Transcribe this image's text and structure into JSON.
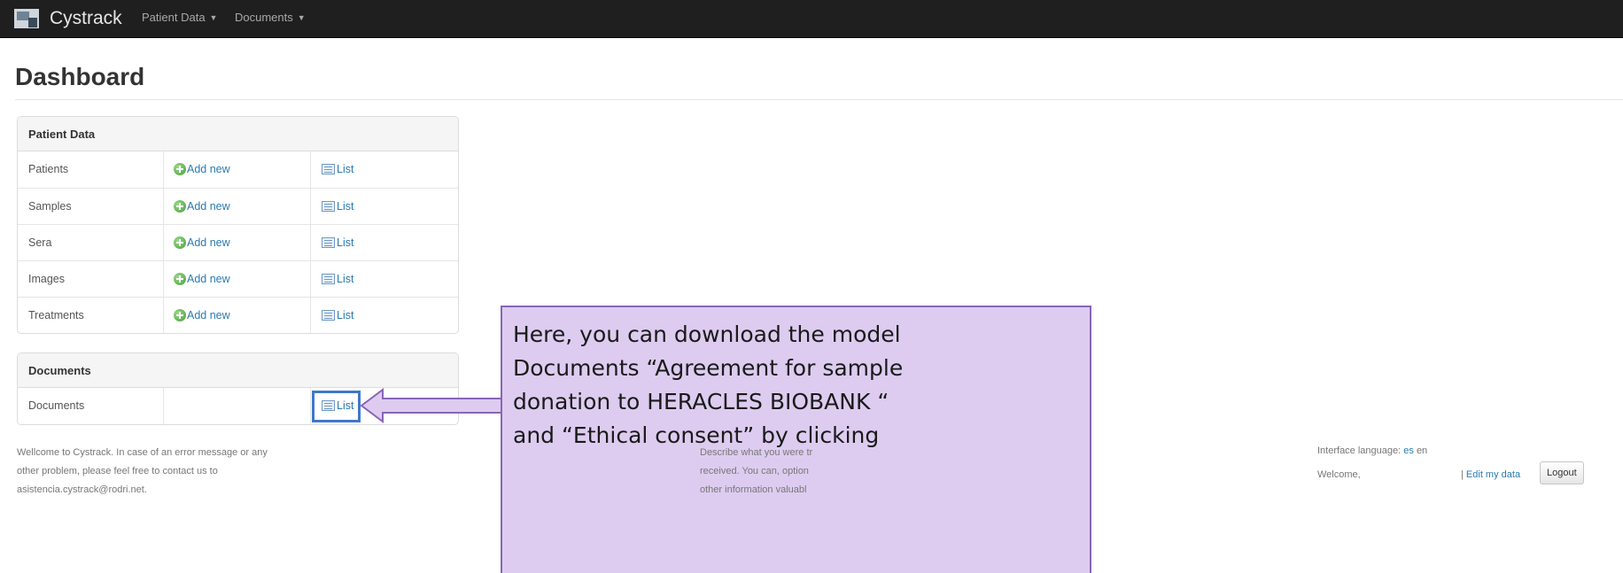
{
  "navbar": {
    "brand": "Cystrack",
    "menus": [
      "Patient Data",
      "Documents"
    ]
  },
  "page": {
    "title": "Dashboard"
  },
  "patient_panel": {
    "heading": "Patient Data",
    "rows": [
      {
        "label": "Patients",
        "add": "Add new",
        "list": "List"
      },
      {
        "label": "Samples",
        "add": "Add new",
        "list": "List"
      },
      {
        "label": "Sera",
        "add": "Add new",
        "list": "List"
      },
      {
        "label": "Images",
        "add": "Add new",
        "list": "List"
      },
      {
        "label": "Treatments",
        "add": "Add new",
        "list": "List"
      }
    ]
  },
  "documents_panel": {
    "heading": "Documents",
    "rows": [
      {
        "label": "Documents",
        "list": "List"
      }
    ]
  },
  "callout": {
    "lines": [
      "Here, you can download the model",
      "Documents  “Agreement for sample",
      "donation to HERACLES BIOBANK “",
      "and “Ethical consent” by clicking"
    ]
  },
  "footer": {
    "left_lines": [
      "Wellcome to Cystrack. In case of an error message or any",
      "other problem, please feel free to contact us to",
      "asistencia.cystrack@rodri.net."
    ],
    "mid_lines": [
      "Describe what you were tr",
      "received. You can, option",
      "other information valuabl"
    ],
    "language_label": "Interface language:",
    "lang_es": "es",
    "lang_en": "en",
    "welcome": "Welcome,",
    "edit_sep": "|",
    "edit_my_data": "Edit my data",
    "logout": "Logout"
  },
  "colors": {
    "navbar": "#1f1f1f",
    "link": "#2a7ab0",
    "highlight": "#3f78c8",
    "callout_bg": "#ddccf0",
    "callout_border": "#8a64b8"
  }
}
